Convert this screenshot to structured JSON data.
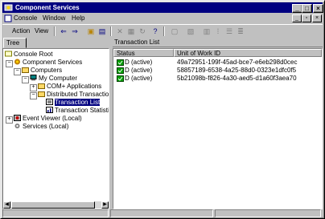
{
  "window": {
    "title": "Component Services"
  },
  "menubar": {
    "items": [
      "Console",
      "Window",
      "Help"
    ]
  },
  "toolbar": {
    "action_label": "Action",
    "view_label": "View"
  },
  "tree_tab": {
    "label": "Tree"
  },
  "tree": {
    "root": "Console Root",
    "component_services": "Component Services",
    "computers": "Computers",
    "my_computer": "My Computer",
    "com_apps": "COM+ Applications",
    "dtc": "Distributed Transaction I",
    "transaction_list": "Transaction List",
    "transaction_statistics": "Transaction Statistic",
    "event_viewer": "Event Viewer (Local)",
    "services": "Services (Local)"
  },
  "right_pane": {
    "title": "Transaction List",
    "columns": [
      "Status",
      "Unit of Work ID"
    ],
    "rows": [
      {
        "status": "D (active)",
        "uow": "49a72951-199f-45ad-bce7-e6eb298d0cec"
      },
      {
        "status": "D (active)",
        "uow": "58857189-6538-4a25-88d0-0323e1dfc0f5"
      },
      {
        "status": "D (active)",
        "uow": "5b21098b-f826-4a30-aed5-d1a60f3aea70"
      }
    ]
  },
  "colors": {
    "title_bar": "#000080",
    "face": "#c0c0c0",
    "selection": "#000080"
  }
}
